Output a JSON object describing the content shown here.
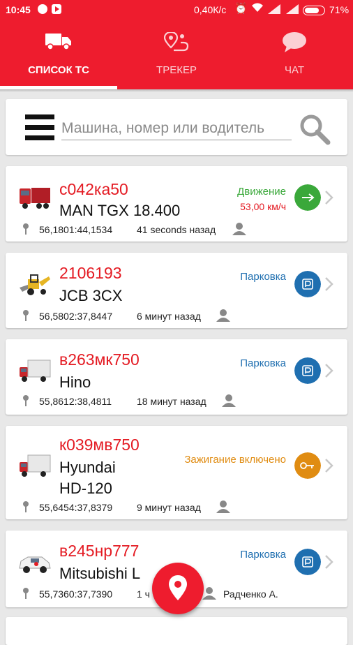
{
  "status_bar": {
    "time": "10:45",
    "network_speed": "0,40К/с",
    "battery": "71%"
  },
  "tabs": [
    {
      "label": "СПИСОК ТС",
      "icon": "truck-icon",
      "active": true
    },
    {
      "label": "ТРЕКЕР",
      "icon": "route-pin-icon",
      "active": false
    },
    {
      "label": "ЧАТ",
      "icon": "chat-bubble-icon",
      "active": false
    }
  ],
  "search": {
    "placeholder": "Машина, номер или водитель"
  },
  "vehicles": [
    {
      "plate": "с042ка50",
      "model": "MAN TGX 18.400",
      "status": "Движение",
      "speed": "53,00 км/ч",
      "status_icon": "arrow-right-icon",
      "status_color": "#3aa83a",
      "coords": "56,1801:44,1534",
      "ago": "41 seconds назад",
      "driver": ""
    },
    {
      "plate": "2106193",
      "model": "JCB 3CX",
      "status": "Парковка",
      "status_icon": "parking-icon",
      "status_color": "#1f6fb0",
      "coords": "56,5802:37,8447",
      "ago": "6 минут назад",
      "driver": ""
    },
    {
      "plate": "в263мк750",
      "model": "Hino",
      "status": "Парковка",
      "status_icon": "parking-icon",
      "status_color": "#1f6fb0",
      "coords": "55,8612:38,4811",
      "ago": "18 минут назад",
      "driver": ""
    },
    {
      "plate": "к039мв750",
      "model_line1": "Hyundai",
      "model_line2": "HD-120",
      "status": "Зажигание включено",
      "status_icon": "key-icon",
      "status_color": "#e08c12",
      "coords": "55,6454:37,8379",
      "ago": "9 минут назад",
      "driver": ""
    },
    {
      "plate": "в245нр777",
      "model": "Mitsubishi L",
      "status": "Парковка",
      "status_icon": "parking-icon",
      "status_color": "#1f6fb0",
      "coords": "55,7360:37,7390",
      "ago": "1 ч",
      "driver": "Радченко А."
    }
  ],
  "colors": {
    "brand_red": "#ee1c2e",
    "plate_red": "#e41b23"
  }
}
